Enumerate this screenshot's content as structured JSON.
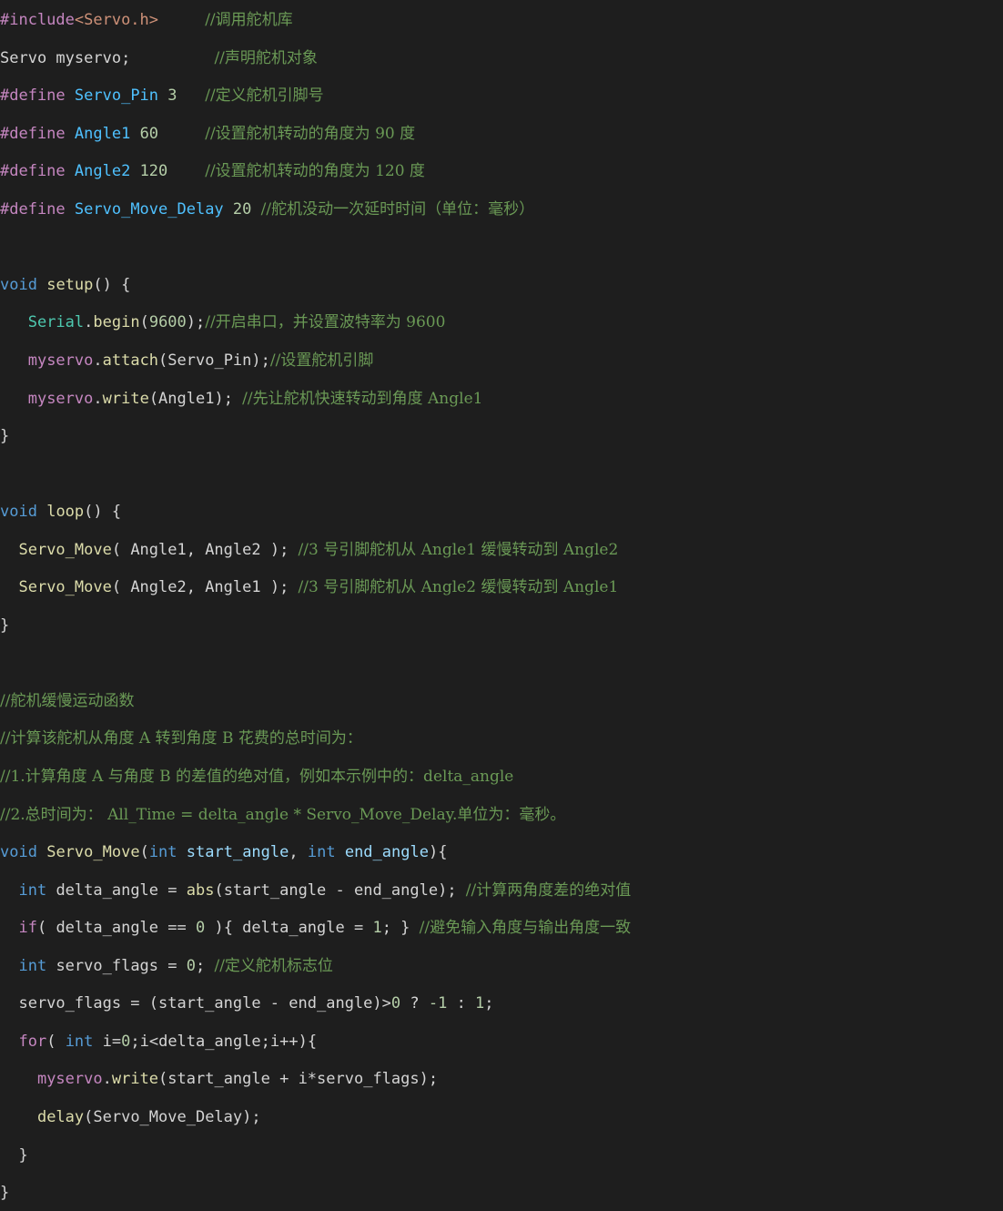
{
  "code_lines": [
    [
      {
        "t": "#include",
        "c": "pp"
      },
      {
        "t": "<Servo.h>",
        "c": "inc"
      },
      {
        "t": "     ",
        "c": "plain"
      },
      {
        "t": "//调用舵机库",
        "c": "cm"
      }
    ],
    [
      {
        "t": "Servo",
        "c": "plain"
      },
      {
        "t": " myservo;",
        "c": "plain"
      },
      {
        "t": "         ",
        "c": "plain"
      },
      {
        "t": "//声明舵机对象",
        "c": "cm"
      }
    ],
    [
      {
        "t": "#define",
        "c": "pp"
      },
      {
        "t": " ",
        "c": "plain"
      },
      {
        "t": "Servo_Pin",
        "c": "mac"
      },
      {
        "t": " 3   ",
        "c": "num"
      },
      {
        "t": "//定义舵机引脚号",
        "c": "cm"
      }
    ],
    [
      {
        "t": "#define",
        "c": "pp"
      },
      {
        "t": " ",
        "c": "plain"
      },
      {
        "t": "Angle1",
        "c": "mac"
      },
      {
        "t": " 60     ",
        "c": "num"
      },
      {
        "t": "//设置舵机转动的角度为 90 度",
        "c": "cm"
      }
    ],
    [
      {
        "t": "#define",
        "c": "pp"
      },
      {
        "t": " ",
        "c": "plain"
      },
      {
        "t": "Angle2",
        "c": "mac"
      },
      {
        "t": " 120    ",
        "c": "num"
      },
      {
        "t": "//设置舵机转动的角度为 120 度",
        "c": "cm"
      }
    ],
    [
      {
        "t": "#define",
        "c": "pp"
      },
      {
        "t": " ",
        "c": "plain"
      },
      {
        "t": "Servo_Move_Delay",
        "c": "mac"
      },
      {
        "t": " 20 ",
        "c": "num"
      },
      {
        "t": "//舵机没动一次延时时间（单位：毫秒）",
        "c": "cm"
      }
    ],
    [],
    [
      {
        "t": "void",
        "c": "kw"
      },
      {
        "t": " ",
        "c": "plain"
      },
      {
        "t": "setup",
        "c": "fn"
      },
      {
        "t": "() {",
        "c": "plain"
      }
    ],
    [
      {
        "t": "   ",
        "c": "plain"
      },
      {
        "t": "Serial",
        "c": "type"
      },
      {
        "t": ".",
        "c": "plain"
      },
      {
        "t": "begin",
        "c": "fn"
      },
      {
        "t": "(",
        "c": "plain"
      },
      {
        "t": "9600",
        "c": "num"
      },
      {
        "t": ");",
        "c": "plain"
      },
      {
        "t": "//开启串口，并设置波特率为 9600",
        "c": "cm"
      }
    ],
    [
      {
        "t": "   ",
        "c": "plain"
      },
      {
        "t": "myservo",
        "c": "ctl"
      },
      {
        "t": ".",
        "c": "plain"
      },
      {
        "t": "attach",
        "c": "fn"
      },
      {
        "t": "(Servo_Pin);",
        "c": "plain"
      },
      {
        "t": "//设置舵机引脚",
        "c": "cm"
      }
    ],
    [
      {
        "t": "   ",
        "c": "plain"
      },
      {
        "t": "myservo",
        "c": "ctl"
      },
      {
        "t": ".",
        "c": "plain"
      },
      {
        "t": "write",
        "c": "fn"
      },
      {
        "t": "(Angle1); ",
        "c": "plain"
      },
      {
        "t": "//先让舵机快速转动到角度 Angle1",
        "c": "cm"
      }
    ],
    [
      {
        "t": "}",
        "c": "plain"
      }
    ],
    [],
    [
      {
        "t": "void",
        "c": "kw"
      },
      {
        "t": " ",
        "c": "plain"
      },
      {
        "t": "loop",
        "c": "fn"
      },
      {
        "t": "() {",
        "c": "plain"
      }
    ],
    [
      {
        "t": "  ",
        "c": "plain"
      },
      {
        "t": "Servo_Move",
        "c": "fn"
      },
      {
        "t": "( Angle1, Angle2 ); ",
        "c": "plain"
      },
      {
        "t": "//3 号引脚舵机从 Angle1 缓慢转动到 Angle2",
        "c": "cm"
      }
    ],
    [
      {
        "t": "  ",
        "c": "plain"
      },
      {
        "t": "Servo_Move",
        "c": "fn"
      },
      {
        "t": "( Angle2, Angle1 ); ",
        "c": "plain"
      },
      {
        "t": "//3 号引脚舵机从 Angle2 缓慢转动到 Angle1",
        "c": "cm"
      }
    ],
    [
      {
        "t": "}",
        "c": "plain"
      }
    ],
    [],
    [
      {
        "t": "//舵机缓慢运动函数",
        "c": "cm"
      }
    ],
    [
      {
        "t": "//计算该舵机从角度 A 转到角度 B 花费的总时间为：",
        "c": "cm"
      }
    ],
    [
      {
        "t": "//1.计算角度 A 与角度 B 的差值的绝对值，例如本示例中的：delta_angle",
        "c": "cm"
      }
    ],
    [
      {
        "t": "//2.总时间为： All_Time = delta_angle * Servo_Move_Delay.单位为：毫秒。",
        "c": "cm"
      }
    ],
    [
      {
        "t": "void",
        "c": "kw"
      },
      {
        "t": " ",
        "c": "plain"
      },
      {
        "t": "Servo_Move",
        "c": "fn"
      },
      {
        "t": "(",
        "c": "plain"
      },
      {
        "t": "int",
        "c": "kw"
      },
      {
        "t": " ",
        "c": "plain"
      },
      {
        "t": "start_angle",
        "c": "var"
      },
      {
        "t": ", ",
        "c": "plain"
      },
      {
        "t": "int",
        "c": "kw"
      },
      {
        "t": " ",
        "c": "plain"
      },
      {
        "t": "end_angle",
        "c": "var"
      },
      {
        "t": "){",
        "c": "plain"
      }
    ],
    [
      {
        "t": "  ",
        "c": "plain"
      },
      {
        "t": "int",
        "c": "kw"
      },
      {
        "t": " delta_angle = ",
        "c": "plain"
      },
      {
        "t": "abs",
        "c": "fn"
      },
      {
        "t": "(start_angle - end_angle); ",
        "c": "plain"
      },
      {
        "t": "//计算两角度差的绝对值",
        "c": "cm"
      }
    ],
    [
      {
        "t": "  ",
        "c": "plain"
      },
      {
        "t": "if",
        "c": "ctl"
      },
      {
        "t": "( delta_angle == ",
        "c": "plain"
      },
      {
        "t": "0",
        "c": "num"
      },
      {
        "t": " ){ delta_angle = ",
        "c": "plain"
      },
      {
        "t": "1",
        "c": "num"
      },
      {
        "t": "; } ",
        "c": "plain"
      },
      {
        "t": "//避免输入角度与输出角度一致",
        "c": "cm"
      }
    ],
    [
      {
        "t": "  ",
        "c": "plain"
      },
      {
        "t": "int",
        "c": "kw"
      },
      {
        "t": " servo_flags = ",
        "c": "plain"
      },
      {
        "t": "0",
        "c": "num"
      },
      {
        "t": "; ",
        "c": "plain"
      },
      {
        "t": "//定义舵机标志位",
        "c": "cm"
      }
    ],
    [
      {
        "t": "  servo_flags = (start_angle - end_angle)>",
        "c": "plain"
      },
      {
        "t": "0",
        "c": "num"
      },
      {
        "t": " ? ",
        "c": "plain"
      },
      {
        "t": "-1",
        "c": "num"
      },
      {
        "t": " : ",
        "c": "plain"
      },
      {
        "t": "1",
        "c": "num"
      },
      {
        "t": ";",
        "c": "plain"
      }
    ],
    [
      {
        "t": "  ",
        "c": "plain"
      },
      {
        "t": "for",
        "c": "ctl"
      },
      {
        "t": "( ",
        "c": "plain"
      },
      {
        "t": "int",
        "c": "kw"
      },
      {
        "t": " i=",
        "c": "plain"
      },
      {
        "t": "0",
        "c": "num"
      },
      {
        "t": ";i<delta_angle;i++){",
        "c": "plain"
      }
    ],
    [
      {
        "t": "    ",
        "c": "plain"
      },
      {
        "t": "myservo",
        "c": "ctl"
      },
      {
        "t": ".",
        "c": "plain"
      },
      {
        "t": "write",
        "c": "fn"
      },
      {
        "t": "(start_angle + i*servo_flags);",
        "c": "plain"
      }
    ],
    [
      {
        "t": "    ",
        "c": "plain"
      },
      {
        "t": "delay",
        "c": "fn"
      },
      {
        "t": "(Servo_Move_Delay);",
        "c": "plain"
      }
    ],
    [
      {
        "t": "  }",
        "c": "plain"
      }
    ],
    [
      {
        "t": "}",
        "c": "plain"
      }
    ]
  ]
}
